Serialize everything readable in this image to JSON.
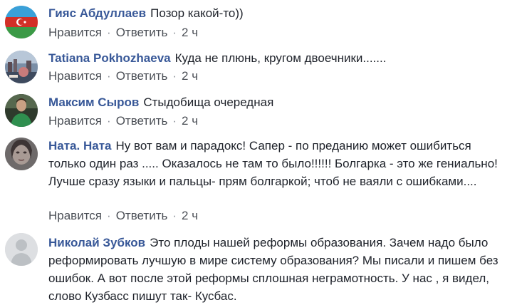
{
  "comments": [
    {
      "author": "Гияс Абдуллаев",
      "text": "Позор какой-то))",
      "like": "Нравится",
      "reply": "Ответить",
      "time": "2 ч",
      "avatar": "azerbaijan-flag-avatar"
    },
    {
      "author": "Tatiana Pokhozhaeva",
      "text": "Куда не плюнь, кругом двоечники.......",
      "like": "Нравится",
      "reply": "Ответить",
      "time": "2 ч",
      "avatar": "city-photo-avatar"
    },
    {
      "author": "Максим Сыров",
      "text": "Стыдобища очередная",
      "like": "Нравится",
      "reply": "Ответить",
      "time": "2 ч",
      "avatar": "person-photo-avatar"
    },
    {
      "author": "Ната. Ната",
      "text": "Ну вот вам и парадокс! Сапер - по преданию может ошибиться только один раз ..... Оказалось не там то было!!!!!! Болгарка - это же гениально! Лучше сразу языки и пальцы- прям болгаркой; чтоб не ваяли с ошибками....",
      "like": "Нравится",
      "reply": "Ответить",
      "time": "2 ч",
      "avatar": "portrait-photo-avatar"
    },
    {
      "author": "Николай Зубков",
      "text": "Это плоды нашей реформы образования. Зачем надо было реформировать лучшую в мире систему образования? Мы писали и пишем без ошибок. А вот после этой реформы сплошная неграмотность. У нас , я видел, слово Кузбасс пишут так- Кусбас.",
      "avatar": "default-user-avatar"
    }
  ],
  "separator": "·"
}
